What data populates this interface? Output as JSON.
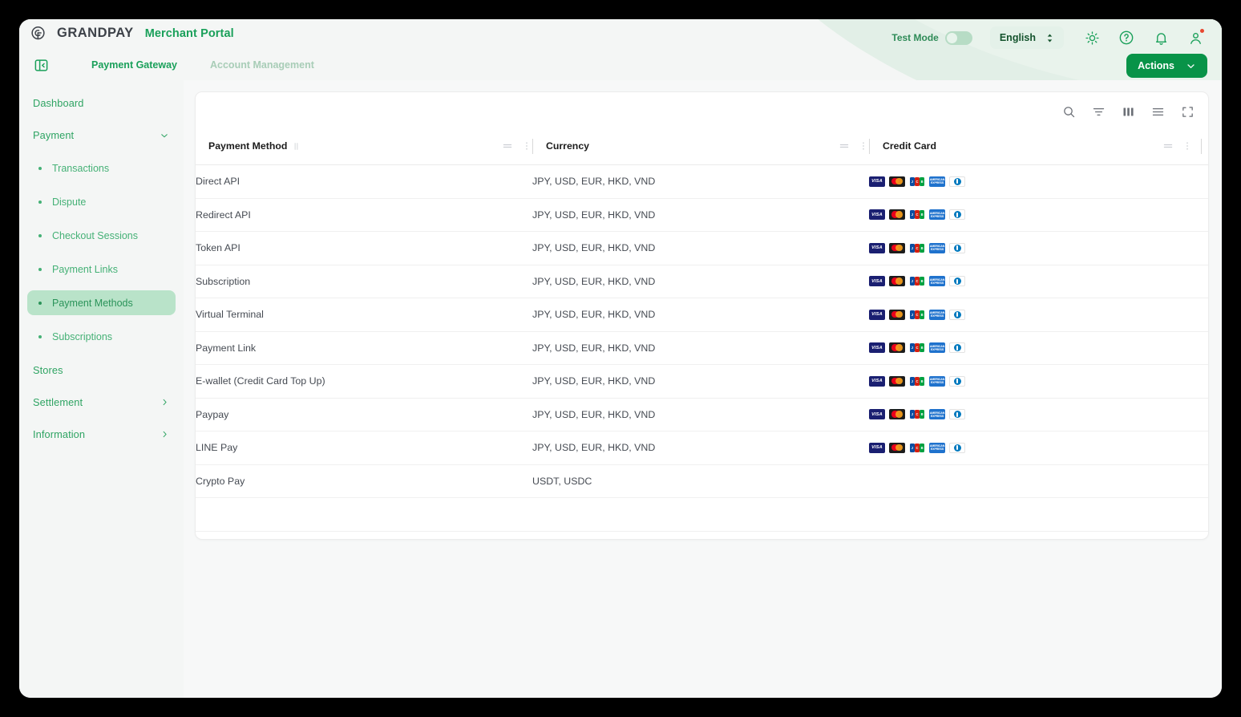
{
  "brand": {
    "logo_icon": "grandpay-circle-g-icon",
    "name": "GRANDPAY",
    "portal": "Merchant Portal"
  },
  "header": {
    "collapse_icon": "panel-collapse-icon",
    "tabs": [
      {
        "label": "Payment Gateway",
        "active": true
      },
      {
        "label": "Account Management",
        "active": false
      }
    ],
    "test_mode_label": "Test Mode",
    "test_mode_on": false,
    "language": "English",
    "language_chevron_icon": "chevron-updown-icon",
    "icons": [
      {
        "name": "theme-sun-icon"
      },
      {
        "name": "help-circle-icon"
      },
      {
        "name": "notification-bell-icon",
        "badge": true
      },
      {
        "name": "user-account-icon",
        "badge": true
      }
    ],
    "actions_label": "Actions",
    "actions_chevron_icon": "chevron-down-icon",
    "accent_color": "#089348",
    "brand_green": "#1aa05a"
  },
  "sidebar": {
    "items": [
      {
        "label": "Dashboard",
        "type": "top",
        "chevron": "none"
      },
      {
        "label": "Payment",
        "type": "top",
        "chevron": "down"
      }
    ],
    "sub_items": [
      {
        "label": "Transactions",
        "selected": false
      },
      {
        "label": "Dispute",
        "selected": false
      },
      {
        "label": "Checkout Sessions",
        "selected": false
      },
      {
        "label": "Payment Links",
        "selected": false
      },
      {
        "label": "Payment Methods",
        "selected": true
      },
      {
        "label": "Subscriptions",
        "selected": false
      }
    ],
    "bottom_items": [
      {
        "label": "Stores",
        "chevron": "none"
      },
      {
        "label": "Settlement",
        "chevron": "right"
      },
      {
        "label": "Information",
        "chevron": "right"
      }
    ]
  },
  "toolbar": {
    "icons": [
      {
        "name": "search-icon"
      },
      {
        "name": "filter-icon"
      },
      {
        "name": "columns-icon"
      },
      {
        "name": "density-list-icon"
      },
      {
        "name": "fullscreen-icon"
      }
    ]
  },
  "table": {
    "columns": [
      {
        "label": "Payment Method",
        "sort_icon": "sort-updown-icon",
        "menu_icon": "column-menu-icon",
        "more_icon": "column-more-icon"
      },
      {
        "label": "Currency",
        "menu_icon": "column-menu-icon",
        "more_icon": "column-more-icon"
      },
      {
        "label": "Credit Card",
        "menu_icon": "column-menu-icon",
        "more_icon": "column-more-icon"
      }
    ],
    "card_brands": [
      "visa",
      "mastercard",
      "jcb",
      "amex",
      "diners"
    ],
    "rows": [
      {
        "method": "Direct API",
        "currency": "JPY, USD, EUR, HKD, VND",
        "has_cards": true
      },
      {
        "method": "Redirect API",
        "currency": "JPY, USD, EUR, HKD, VND",
        "has_cards": true
      },
      {
        "method": "Token API",
        "currency": "JPY, USD, EUR, HKD, VND",
        "has_cards": true
      },
      {
        "method": "Subscription",
        "currency": "JPY, USD, EUR, HKD, VND",
        "has_cards": true
      },
      {
        "method": "Virtual Terminal",
        "currency": "JPY, USD, EUR, HKD, VND",
        "has_cards": true
      },
      {
        "method": "Payment Link",
        "currency": "JPY, USD, EUR, HKD, VND",
        "has_cards": true
      },
      {
        "method": "E-wallet (Credit Card Top Up)",
        "currency": "JPY, USD, EUR, HKD, VND",
        "has_cards": true
      },
      {
        "method": "Paypay",
        "currency": "JPY, USD, EUR, HKD, VND",
        "has_cards": true
      },
      {
        "method": "LINE Pay",
        "currency": "JPY, USD, EUR, HKD, VND",
        "has_cards": true
      },
      {
        "method": "Crypto Pay",
        "currency": "USDT, USDC",
        "has_cards": false
      }
    ]
  }
}
